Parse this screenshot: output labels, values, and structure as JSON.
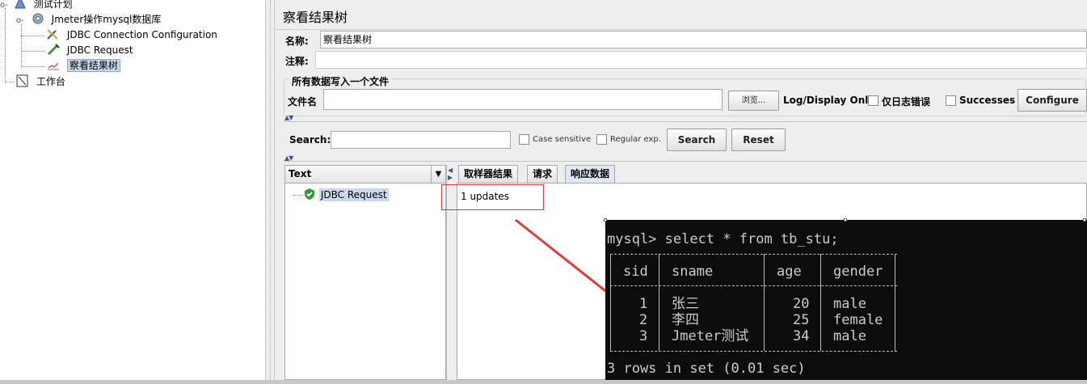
{
  "tree": {
    "test_plan": "测试计划",
    "thread_group": "Jmeter操作mysql数据库",
    "jdbc_config": "JDBC Connection Configuration",
    "jdbc_request": "JDBC Request",
    "result_tree": "察看结果树",
    "workbench": "工作台"
  },
  "panel": {
    "title": "察看结果树",
    "name_label": "名称:",
    "name_value": "察看结果树",
    "comment_label": "注释:",
    "comment_value": "",
    "file_group_title": "所有数据写入一个文件",
    "filename_label": "文件名",
    "filename_value": "",
    "browse_label": "浏览...",
    "log_display_label": "Log/Display Only:",
    "errors_only_label": "仅日志错误",
    "successes_label": "Successes",
    "configure_label": "Configure"
  },
  "search": {
    "label": "Search:",
    "value": "",
    "case_sensitive_label": "Case sensitive",
    "regex_label": "Regular exp.",
    "search_button": "Search",
    "reset_button": "Reset"
  },
  "results": {
    "renderer": "Text",
    "sample": "JDBC Request",
    "tabs": [
      "取样器结果",
      "请求",
      "响应数据"
    ],
    "active_tab": "响应数据",
    "response_text": "1 updates"
  },
  "terminal": {
    "command": "mysql> select * from tb_stu;",
    "columns": [
      "sid",
      "sname",
      "age",
      "gender"
    ],
    "rows": [
      [
        "1",
        "张三",
        "20",
        "male"
      ],
      [
        "2",
        "李四",
        "25",
        "female"
      ],
      [
        "3",
        "Jmeter测试",
        "34",
        "male"
      ]
    ],
    "footer": "3 rows in set (0.01 sec)"
  },
  "colors": {
    "annotation_red": "#e23a3a",
    "terminal_bg": "#0c0c0c",
    "selection_bg": "#c9d8ee"
  }
}
